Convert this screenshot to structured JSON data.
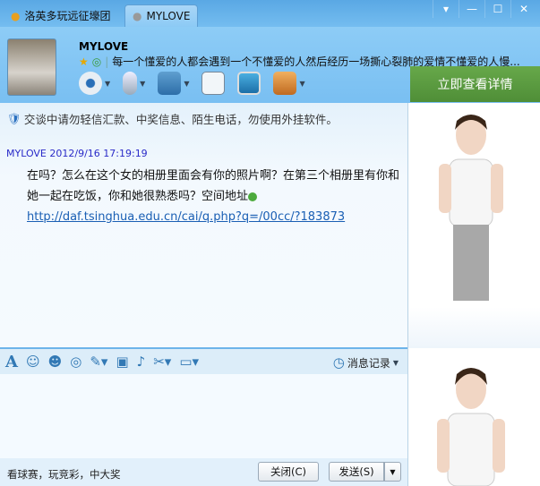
{
  "tabs": [
    {
      "label": "洛英多玩远征壕团",
      "icon": "group-icon"
    },
    {
      "label": "MYLOVE",
      "icon": "status-icon"
    }
  ],
  "window_buttons": [
    "menu",
    "minimize",
    "maximize",
    "close"
  ],
  "contact": {
    "name": "MYLOVE",
    "signature": "每一个懂爱的人都会遇到一个不懂爱的人然后经历一场撕心裂肺的爱情不懂爱的人慢..."
  },
  "promo_label": "立即查看详情",
  "notice": "交谈中请勿轻信汇款、中奖信息、陌生电话，勿使用外挂软件。",
  "message": {
    "sender_time": "MYLOVE 2012/9/16 17:19:19",
    "text": "在吗？怎么在这个女的相册里面会有你的照片啊？在第三个相册里有你和她一起在吃饭，你和她很熟悉吗？空间地址",
    "link": "http://daf.tsinghua.edu.cn/cai/q.php?q=/00cc/?183873"
  },
  "history_label": "消息记录",
  "bottom": {
    "ad": "看球赛，玩竞彩，中大奖",
    "close": "关闭(C)",
    "send": "发送(S)"
  }
}
